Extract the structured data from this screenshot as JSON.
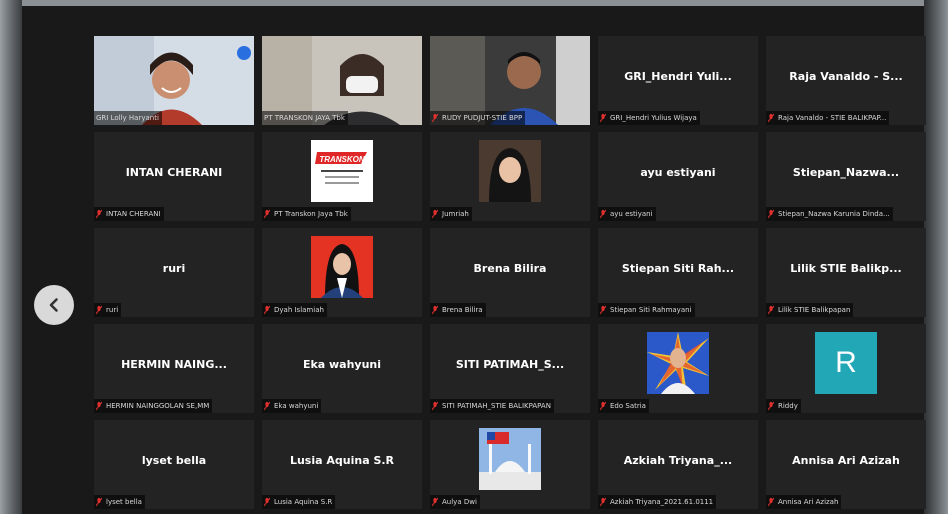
{
  "colors": {
    "background": "#191919",
    "tile": "#232323",
    "mic_muted": "#e0322d",
    "avatar_r": "#22a7b6",
    "nav_button": "#d9d9d9"
  },
  "nav": {
    "prev_icon": "chevron-left-icon"
  },
  "participants": [
    {
      "label": "GRI Lolly Haryanti",
      "center_name": "",
      "kind": "video",
      "mic_muted": false
    },
    {
      "label": "PT TRANSKON JAYA Tbk",
      "center_name": "",
      "kind": "video",
      "mic_muted": false
    },
    {
      "label": "RUDY PUDJUT-STIE BPP",
      "center_name": "",
      "kind": "video",
      "mic_muted": true
    },
    {
      "label": "GRI_Hendri Yulius Wijaya",
      "center_name": "GRI_Hendri Yuli...",
      "kind": "name",
      "mic_muted": true
    },
    {
      "label": "Raja Vanaldo - STIE BALIKPAP...",
      "center_name": "Raja Vanaldo - S...",
      "kind": "name",
      "mic_muted": true
    },
    {
      "label": "INTAN CHERANI",
      "center_name": "INTAN CHERANI",
      "kind": "name",
      "mic_muted": true
    },
    {
      "label": "PT Transkon Jaya Tbk",
      "center_name": "",
      "kind": "logo",
      "mic_muted": true,
      "logo_text": "TRANSKON"
    },
    {
      "label": "Jumriah",
      "center_name": "",
      "kind": "photo",
      "mic_muted": true
    },
    {
      "label": "ayu estiyani",
      "center_name": "ayu estiyani",
      "kind": "name",
      "mic_muted": true
    },
    {
      "label": "Stiepan_Nazwa Karunia Dinda...",
      "center_name": "Stiepan_Nazwa...",
      "kind": "name",
      "mic_muted": true
    },
    {
      "label": "ruri",
      "center_name": "ruri",
      "kind": "name",
      "mic_muted": true
    },
    {
      "label": "Dyah Islamiah",
      "center_name": "",
      "kind": "photo-red",
      "mic_muted": true
    },
    {
      "label": "Brena Bilira",
      "center_name": "Brena Bilira",
      "kind": "name",
      "mic_muted": true
    },
    {
      "label": "Stiepan Siti Rahmayani",
      "center_name": "Stiepan Siti Rah...",
      "kind": "name",
      "mic_muted": true
    },
    {
      "label": "Lilik STIE Balikpapan",
      "center_name": "Lilik STIE Balikp...",
      "kind": "name",
      "mic_muted": true
    },
    {
      "label": "HERMIN NAINGGOLAN SE,MM",
      "center_name": "HERMIN NAING...",
      "kind": "name",
      "mic_muted": true
    },
    {
      "label": "Eka wahyuni",
      "center_name": "Eka wahyuni",
      "kind": "name",
      "mic_muted": true
    },
    {
      "label": "SITI PATIMAH_STIE BALIKPAPAN",
      "center_name": "SITI PATIMAH_S...",
      "kind": "name",
      "mic_muted": true
    },
    {
      "label": "Edo Satria",
      "center_name": "",
      "kind": "photo-burst",
      "mic_muted": true
    },
    {
      "label": "Riddy",
      "center_name": "",
      "kind": "avatar",
      "avatar_letter": "R",
      "mic_muted": true
    },
    {
      "label": "lyset bella",
      "center_name": "lyset bella",
      "kind": "name",
      "mic_muted": true
    },
    {
      "label": "Lusia Aquina S.R",
      "center_name": "Lusia Aquina S.R",
      "kind": "name",
      "mic_muted": true
    },
    {
      "label": "Aulya Dwi",
      "center_name": "",
      "kind": "photo-mosque",
      "mic_muted": true
    },
    {
      "label": "Azkiah Triyana_2021.61.0111",
      "center_name": "Azkiah Triyana_...",
      "kind": "name",
      "mic_muted": true
    },
    {
      "label": "Annisa Ari Azizah",
      "center_name": "Annisa Ari Azizah",
      "kind": "name",
      "mic_muted": true
    }
  ]
}
